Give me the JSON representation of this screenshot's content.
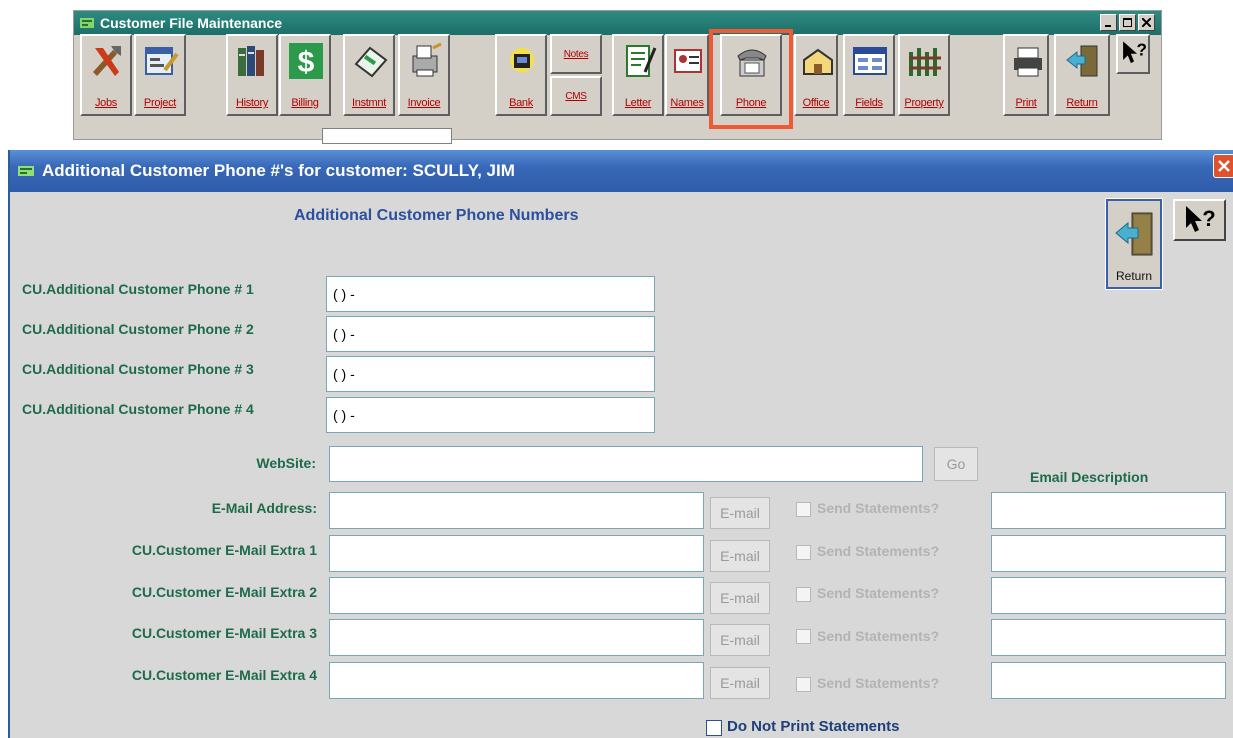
{
  "parent_window": {
    "title": "Customer File Maintenance",
    "toolbar": [
      {
        "label": "Jobs",
        "icon": "tools-icon"
      },
      {
        "label": "Project",
        "icon": "project-icon"
      },
      {
        "label": "History",
        "icon": "books-icon"
      },
      {
        "label": "Billing",
        "icon": "dollar-icon"
      },
      {
        "label": "Instmnt",
        "icon": "installment-icon"
      },
      {
        "label": "Invoice",
        "icon": "invoice-icon"
      },
      {
        "label": "Bank",
        "icon": "bank-icon"
      },
      {
        "label": "Notes",
        "icon": "notes-icon"
      },
      {
        "label": "CMS",
        "icon": "cms-icon"
      },
      {
        "label": "Letter",
        "icon": "letter-icon"
      },
      {
        "label": "Names",
        "icon": "names-icon"
      },
      {
        "label": "Phone",
        "icon": "phone-icon"
      },
      {
        "label": "Office",
        "icon": "office-icon"
      },
      {
        "label": "Fields",
        "icon": "fields-icon"
      },
      {
        "label": "Property",
        "icon": "property-icon"
      },
      {
        "label": "Print",
        "icon": "printer-icon"
      },
      {
        "label": "Return",
        "icon": "return-door-icon"
      },
      {
        "label": "",
        "icon": "help-arrow-icon"
      }
    ],
    "highlight_color": "#ef5a36"
  },
  "dialog": {
    "title": "Additional Customer Phone #'s for customer:  SCULLY, JIM",
    "heading": "Additional Customer Phone Numbers",
    "phones": [
      {
        "label": "CU.Additional Customer Phone # 1",
        "value": "( )  -"
      },
      {
        "label": "CU.Additional Customer Phone # 2",
        "value": "( )  -"
      },
      {
        "label": "CU.Additional Customer Phone # 3",
        "value": "( )  -"
      },
      {
        "label": "CU.Additional Customer Phone # 4",
        "value": "( )  -"
      }
    ],
    "website": {
      "label": "WebSite:",
      "value": "",
      "go_label": "Go"
    },
    "email_description_header": "Email Description",
    "emails": [
      {
        "label": "E-Mail Address:",
        "value": "",
        "button": "E-mail",
        "check_label": "Send Statements?",
        "description": ""
      },
      {
        "label": "CU.Customer E-Mail  Extra 1",
        "value": "",
        "button": "E-mail",
        "check_label": "Send Statements?",
        "description": ""
      },
      {
        "label": "CU.Customer E-Mail  Extra 2",
        "value": "",
        "button": "E-mail",
        "check_label": "Send Statements?",
        "description": ""
      },
      {
        "label": "CU.Customer E-Mail  Extra 3",
        "value": "",
        "button": "E-mail",
        "check_label": "Send Statements?",
        "description": ""
      },
      {
        "label": "CU.Customer E-Mail  Extra 4",
        "value": "",
        "button": "E-mail",
        "check_label": "Send Statements?",
        "description": ""
      }
    ],
    "do_not_print_label": "Do Not Print Statements",
    "return_label": "Return"
  }
}
